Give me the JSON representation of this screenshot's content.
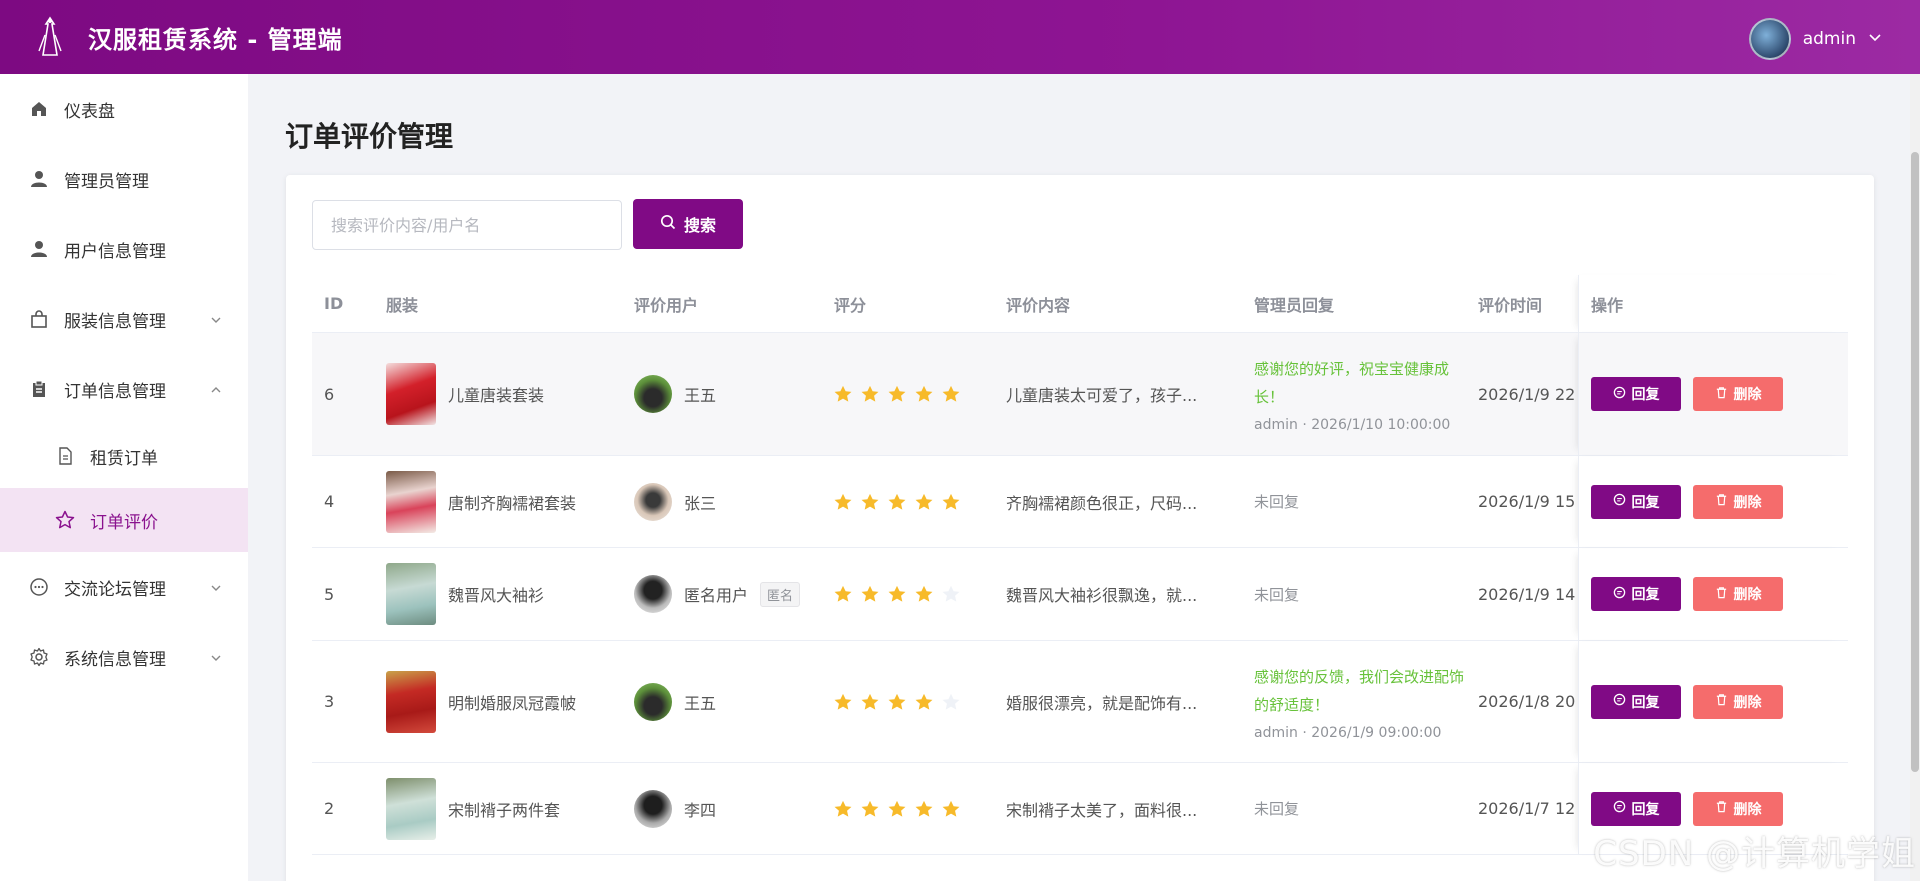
{
  "header": {
    "title": "汉服租赁系统 - 管理端",
    "user": "admin"
  },
  "sidebar": {
    "items": [
      {
        "label": "仪表盘"
      },
      {
        "label": "管理员管理"
      },
      {
        "label": "用户信息管理"
      },
      {
        "label": "服装信息管理"
      },
      {
        "label": "订单信息管理"
      },
      {
        "label": "租赁订单"
      },
      {
        "label": "订单评价"
      },
      {
        "label": "交流论坛管理"
      },
      {
        "label": "系统信息管理"
      }
    ]
  },
  "page": {
    "title": "订单评价管理"
  },
  "search": {
    "placeholder": "搜索评价内容/用户名",
    "button": "搜索"
  },
  "table": {
    "headers": {
      "id": "ID",
      "garment": "服装",
      "user": "评价用户",
      "rating": "评分",
      "content": "评价内容",
      "reply": "管理员回复",
      "time": "评价时间",
      "ops": "操作"
    },
    "reply_label": "回复",
    "delete_label": "删除",
    "rows": [
      {
        "id": "6",
        "garment": "儿童唐装套装",
        "user": "王五",
        "tag": "",
        "rating": 5,
        "content": "儿童唐装太可爱了，孩子...",
        "reply": "感谢您的好评，祝宝宝健康成长！",
        "reply_meta": "admin · 2026/1/10 10:00:00",
        "time": "2026/1/9 22"
      },
      {
        "id": "4",
        "garment": "唐制齐胸襦裙套装",
        "user": "张三",
        "tag": "",
        "rating": 5,
        "content": "齐胸襦裙颜色很正，尺码...",
        "reply": "",
        "reply_meta": "",
        "no_reply": "未回复",
        "time": "2026/1/9 15"
      },
      {
        "id": "5",
        "garment": "魏晋风大袖衫",
        "user": "匿名用户",
        "tag": "匿名",
        "rating": 4,
        "content": "魏晋风大袖衫很飘逸，就...",
        "reply": "",
        "reply_meta": "",
        "no_reply": "未回复",
        "time": "2026/1/9 14"
      },
      {
        "id": "3",
        "garment": "明制婚服凤冠霞帔",
        "user": "王五",
        "tag": "",
        "rating": 4,
        "content": "婚服很漂亮，就是配饰有...",
        "reply": "感谢您的反馈，我们会改进配饰的舒适度！",
        "reply_meta": "admin · 2026/1/9 09:00:00",
        "time": "2026/1/8 20"
      },
      {
        "id": "2",
        "garment": "宋制褙子两件套",
        "user": "李四",
        "tag": "",
        "rating": 5,
        "content": "宋制褙子太美了，面料很...",
        "reply": "",
        "reply_meta": "",
        "no_reply": "未回复",
        "time": "2026/1/7 12"
      }
    ]
  },
  "watermark": "CSDN @计算机学姐",
  "colors": {
    "primary": "#800a85",
    "danger": "#f56c6c",
    "star": "#f7ba2a",
    "reply": "#67c23a"
  }
}
